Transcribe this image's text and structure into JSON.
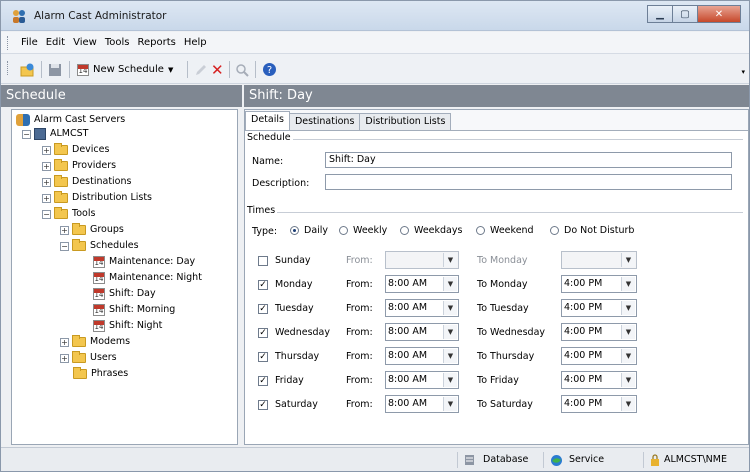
{
  "window": {
    "title": "Alarm Cast Administrator"
  },
  "menu": {
    "file": "File",
    "edit": "Edit",
    "view": "View",
    "tools": "Tools",
    "reports": "Reports",
    "help": "Help"
  },
  "toolbar": {
    "new_schedule": "New Schedule"
  },
  "headers": {
    "left": "Schedule",
    "right": "Shift: Day"
  },
  "tree": {
    "root": "Alarm Cast Servers",
    "server": "ALMCST",
    "devices": "Devices",
    "providers": "Providers",
    "destinations": "Destinations",
    "distribution_lists": "Distribution Lists",
    "tools": "Tools",
    "groups": "Groups",
    "schedules": "Schedules",
    "schedule_items": [
      "Maintenance: Day",
      "Maintenance: Night",
      "Shift: Day",
      "Shift: Morning",
      "Shift: Night"
    ],
    "modems": "Modems",
    "users": "Users",
    "phrases": "Phrases"
  },
  "tabs": [
    "Details",
    "Destinations",
    "Distribution Lists"
  ],
  "schedule": {
    "section": "Schedule",
    "name_label": "Name:",
    "name_value": "Shift: Day",
    "description_label": "Description:",
    "description_value": ""
  },
  "times": {
    "section": "Times",
    "type_label": "Type:",
    "types": [
      "Daily",
      "Weekly",
      "Weekdays",
      "Weekend",
      "Do Not Disturb"
    ],
    "selected_type": "Daily",
    "from_label": "From:",
    "days": [
      {
        "day": "Sunday",
        "checked": false,
        "from": "",
        "to_label": "To Monday",
        "to": ""
      },
      {
        "day": "Monday",
        "checked": true,
        "from": "8:00 AM",
        "to_label": "To Monday",
        "to": "4:00 PM"
      },
      {
        "day": "Tuesday",
        "checked": true,
        "from": "8:00 AM",
        "to_label": "To Tuesday",
        "to": "4:00 PM"
      },
      {
        "day": "Wednesday",
        "checked": true,
        "from": "8:00 AM",
        "to_label": "To Wednesday",
        "to": "4:00 PM"
      },
      {
        "day": "Thursday",
        "checked": true,
        "from": "8:00 AM",
        "to_label": "To Thursday",
        "to": "4:00 PM"
      },
      {
        "day": "Friday",
        "checked": true,
        "from": "8:00 AM",
        "to_label": "To Friday",
        "to": "4:00 PM"
      },
      {
        "day": "Saturday",
        "checked": true,
        "from": "8:00 AM",
        "to_label": "To Saturday",
        "to": "4:00 PM"
      }
    ]
  },
  "status": {
    "database": "Database",
    "service": "Service",
    "user": "ALMCST\\NME"
  },
  "colors": {
    "header_bg": "#7f8792",
    "accent": "#1b3d74",
    "close": "#c6482b"
  }
}
